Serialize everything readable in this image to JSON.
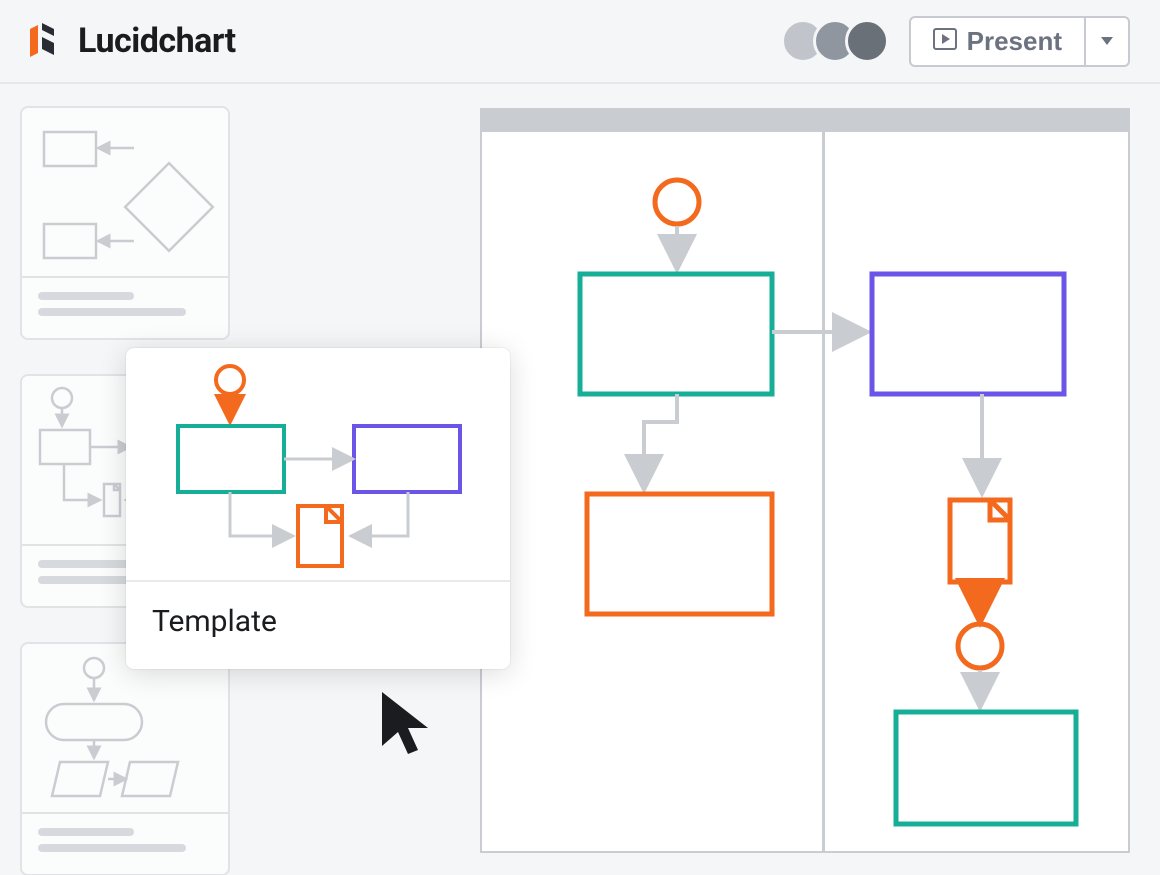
{
  "brand": {
    "name": "Lucidchart"
  },
  "topbar": {
    "present_label": "Present",
    "avatars": [
      {
        "color": "#c1c5cb"
      },
      {
        "color": "#9096a0"
      },
      {
        "color": "#6a7078"
      }
    ]
  },
  "sidebar": {
    "thumbnails": [
      {
        "id": "thumb1"
      },
      {
        "id": "thumb2"
      },
      {
        "id": "thumb3"
      }
    ]
  },
  "popover": {
    "title": "Template"
  },
  "colors": {
    "orange": "#f36a1e",
    "teal": "#17ae97",
    "purple": "#6a55e8",
    "gray_line": "#c9ccd1",
    "gray_fill": "#d6d9dd"
  }
}
